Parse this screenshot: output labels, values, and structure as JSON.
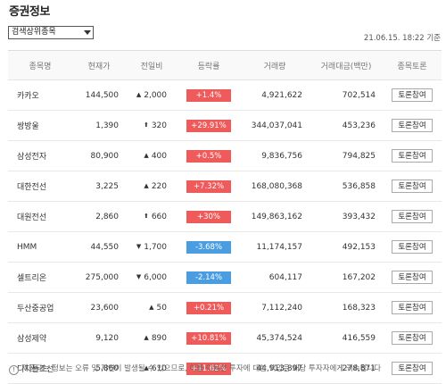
{
  "page": {
    "title": "증권정보"
  },
  "filter": {
    "selected": "검색상위종목"
  },
  "timestamp": "21.06.15. 18:22 기준",
  "columns": [
    "종목명",
    "현재가",
    "전일비",
    "등락률",
    "거래량",
    "거래대금(백만)",
    "종목토론"
  ],
  "rows": [
    {
      "name": "카카오",
      "price": "144,500",
      "change": "2,000",
      "dir": "up",
      "marker": "▲",
      "rate": "+1.4%",
      "volume": "4,921,622",
      "amount": "702,514",
      "action": "토론참여"
    },
    {
      "name": "쌍방울",
      "price": "1,390",
      "change": "320",
      "dir": "up",
      "marker": "⬆",
      "rate": "+29.91%",
      "volume": "344,037,041",
      "amount": "453,236",
      "action": "토론참여"
    },
    {
      "name": "삼성전자",
      "price": "80,900",
      "change": "400",
      "dir": "up",
      "marker": "▲",
      "rate": "+0.5%",
      "volume": "9,836,756",
      "amount": "794,825",
      "action": "토론참여"
    },
    {
      "name": "대한전선",
      "price": "3,225",
      "change": "220",
      "dir": "up",
      "marker": "▲",
      "rate": "+7.32%",
      "volume": "168,080,368",
      "amount": "536,858",
      "action": "토론참여"
    },
    {
      "name": "대원전선",
      "price": "2,860",
      "change": "660",
      "dir": "up",
      "marker": "⬆",
      "rate": "+30%",
      "volume": "149,863,162",
      "amount": "393,432",
      "action": "토론참여"
    },
    {
      "name": "HMM",
      "price": "44,550",
      "change": "1,700",
      "dir": "down",
      "marker": "▼",
      "rate": "-3.68%",
      "volume": "11,174,157",
      "amount": "492,153",
      "action": "토론참여"
    },
    {
      "name": "셀트리온",
      "price": "275,000",
      "change": "6,000",
      "dir": "down",
      "marker": "▼",
      "rate": "-2.14%",
      "volume": "604,117",
      "amount": "167,202",
      "action": "토론참여"
    },
    {
      "name": "두산중공업",
      "price": "23,600",
      "change": "50",
      "dir": "up",
      "marker": "▲",
      "rate": "+0.21%",
      "volume": "7,112,240",
      "amount": "168,323",
      "action": "토론참여"
    },
    {
      "name": "삼성제약",
      "price": "9,120",
      "change": "890",
      "dir": "up",
      "marker": "▲",
      "rate": "+10.81%",
      "volume": "45,374,524",
      "amount": "416,559",
      "action": "토론참여"
    },
    {
      "name": "디지틀조선",
      "price": "5,860",
      "change": "610",
      "dir": "up",
      "marker": "▲",
      "rate": "+11.62%",
      "volume": "44,913,897",
      "amount": "278,871",
      "action": "토론참여"
    }
  ],
  "footer": {
    "icon": "info-icon",
    "text": "제공되는 정보는 오류 및 지연이 발생될 수 있으므로, 이를 이용한 투자에 대한 책임은 해당 투자자에게 귀속됩니다"
  },
  "colors": {
    "up": "#e03131",
    "down": "#1c7ed6",
    "up_badge": "#ef5b5b",
    "down_badge": "#4a9de0"
  }
}
